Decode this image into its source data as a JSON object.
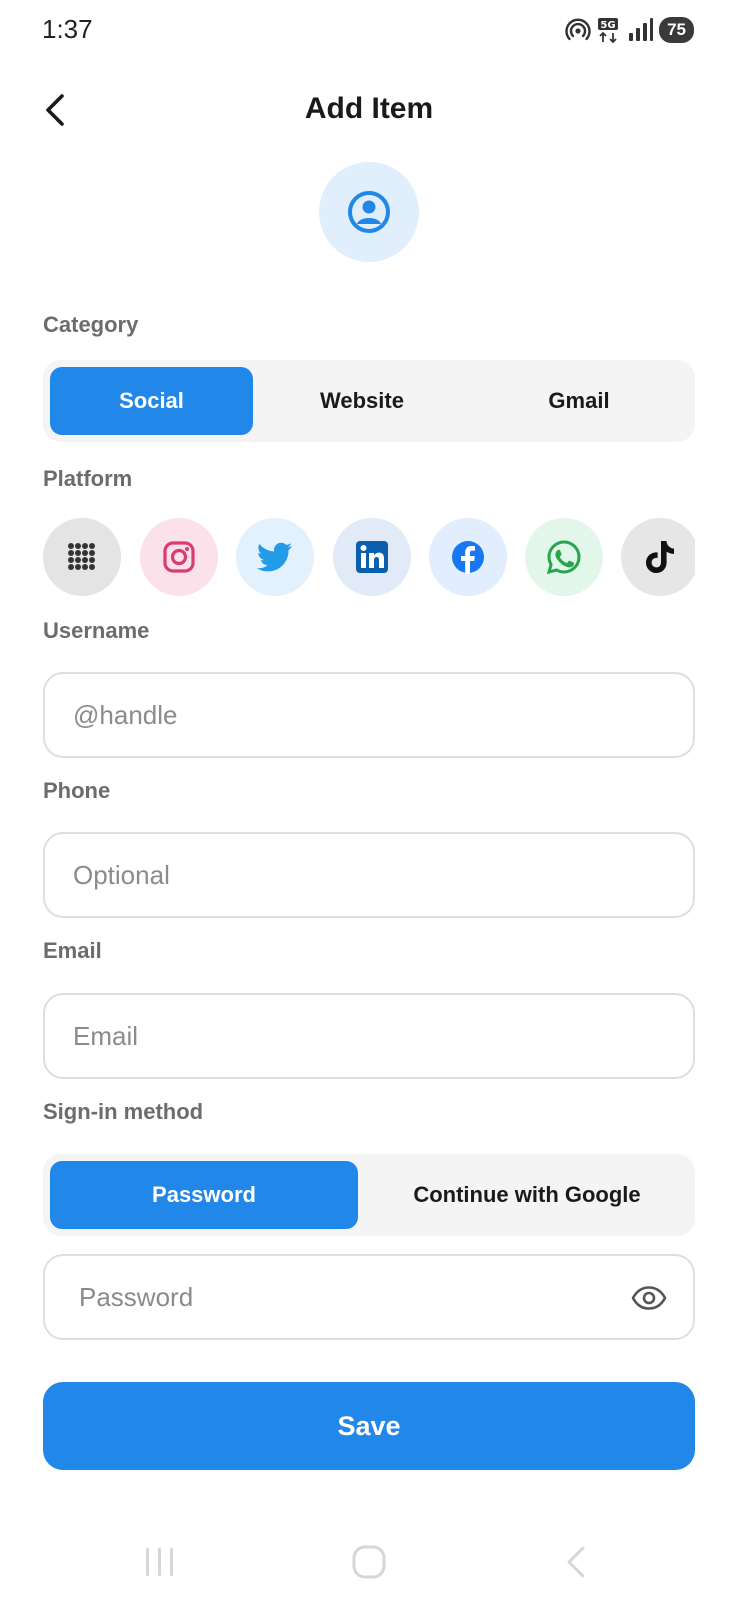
{
  "status_bar": {
    "time": "1:37",
    "battery": "75",
    "network": "5G"
  },
  "header": {
    "title": "Add Item",
    "back_icon": "chevron-left-icon"
  },
  "avatar": {
    "icon": "user-circle-icon",
    "color": "#2187e8",
    "background": "#e1eefb"
  },
  "category": {
    "label": "Category",
    "options": [
      "Social",
      "Website",
      "Gmail"
    ],
    "selected": "Social"
  },
  "platform": {
    "label": "Platform",
    "items": [
      {
        "name": "grid-icon",
        "bg": "#e4e4e4"
      },
      {
        "name": "instagram-icon",
        "bg": "#fbe2ea"
      },
      {
        "name": "twitter-icon",
        "bg": "#e2f1fb"
      },
      {
        "name": "linkedin-icon",
        "bg": "#e1ebf7"
      },
      {
        "name": "facebook-icon",
        "bg": "#e2edfd"
      },
      {
        "name": "whatsapp-icon",
        "bg": "#e2f6ea"
      },
      {
        "name": "tiktok-icon",
        "bg": "#e6e6e6"
      }
    ]
  },
  "username": {
    "label": "Username",
    "value": "",
    "placeholder": "@handle"
  },
  "phone": {
    "label": "Phone",
    "value": "",
    "placeholder": "Optional"
  },
  "email": {
    "label": "Email",
    "value": "",
    "placeholder": "Email"
  },
  "sign_in": {
    "label": "Sign-in method",
    "options": [
      "Password",
      "Continue with Google"
    ],
    "selected": "Password"
  },
  "password": {
    "value": "",
    "placeholder": "Password",
    "toggle_icon": "eye-icon"
  },
  "save": {
    "label": "Save"
  },
  "colors": {
    "accent": "#2187e8",
    "label_gray": "#6c6c6c",
    "input_border": "#dedede"
  }
}
